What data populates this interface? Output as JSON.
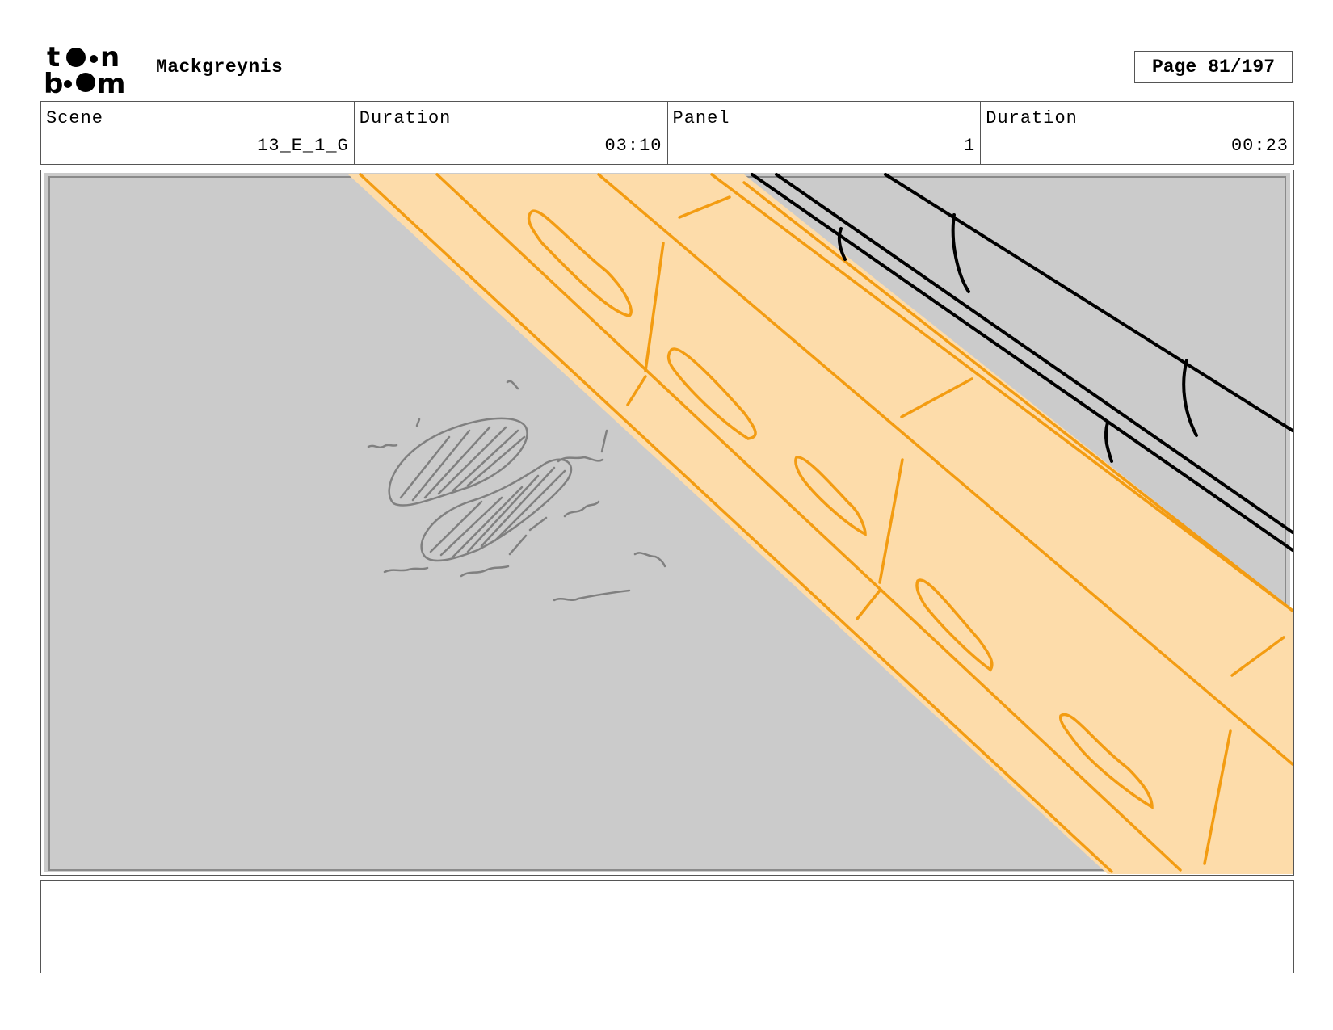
{
  "header": {
    "logo_name": "toon-boom-logo",
    "project_title": "Mackgreynis",
    "page_label": "Page",
    "page_number": "81/197"
  },
  "info": {
    "scene_label": "Scene",
    "scene_value": "13_E_1_G",
    "scene_duration_label": "Duration",
    "scene_duration_value": "03:10",
    "panel_label": "Panel",
    "panel_value": "1",
    "panel_duration_label": "Duration",
    "panel_duration_value": "00:23"
  },
  "panel": {
    "background_color": "#cbcbcb",
    "highlight_color": "#fddcaa",
    "stroke_color": "#f39c12",
    "sketch_color": "#808080"
  },
  "notes": {
    "text": ""
  }
}
